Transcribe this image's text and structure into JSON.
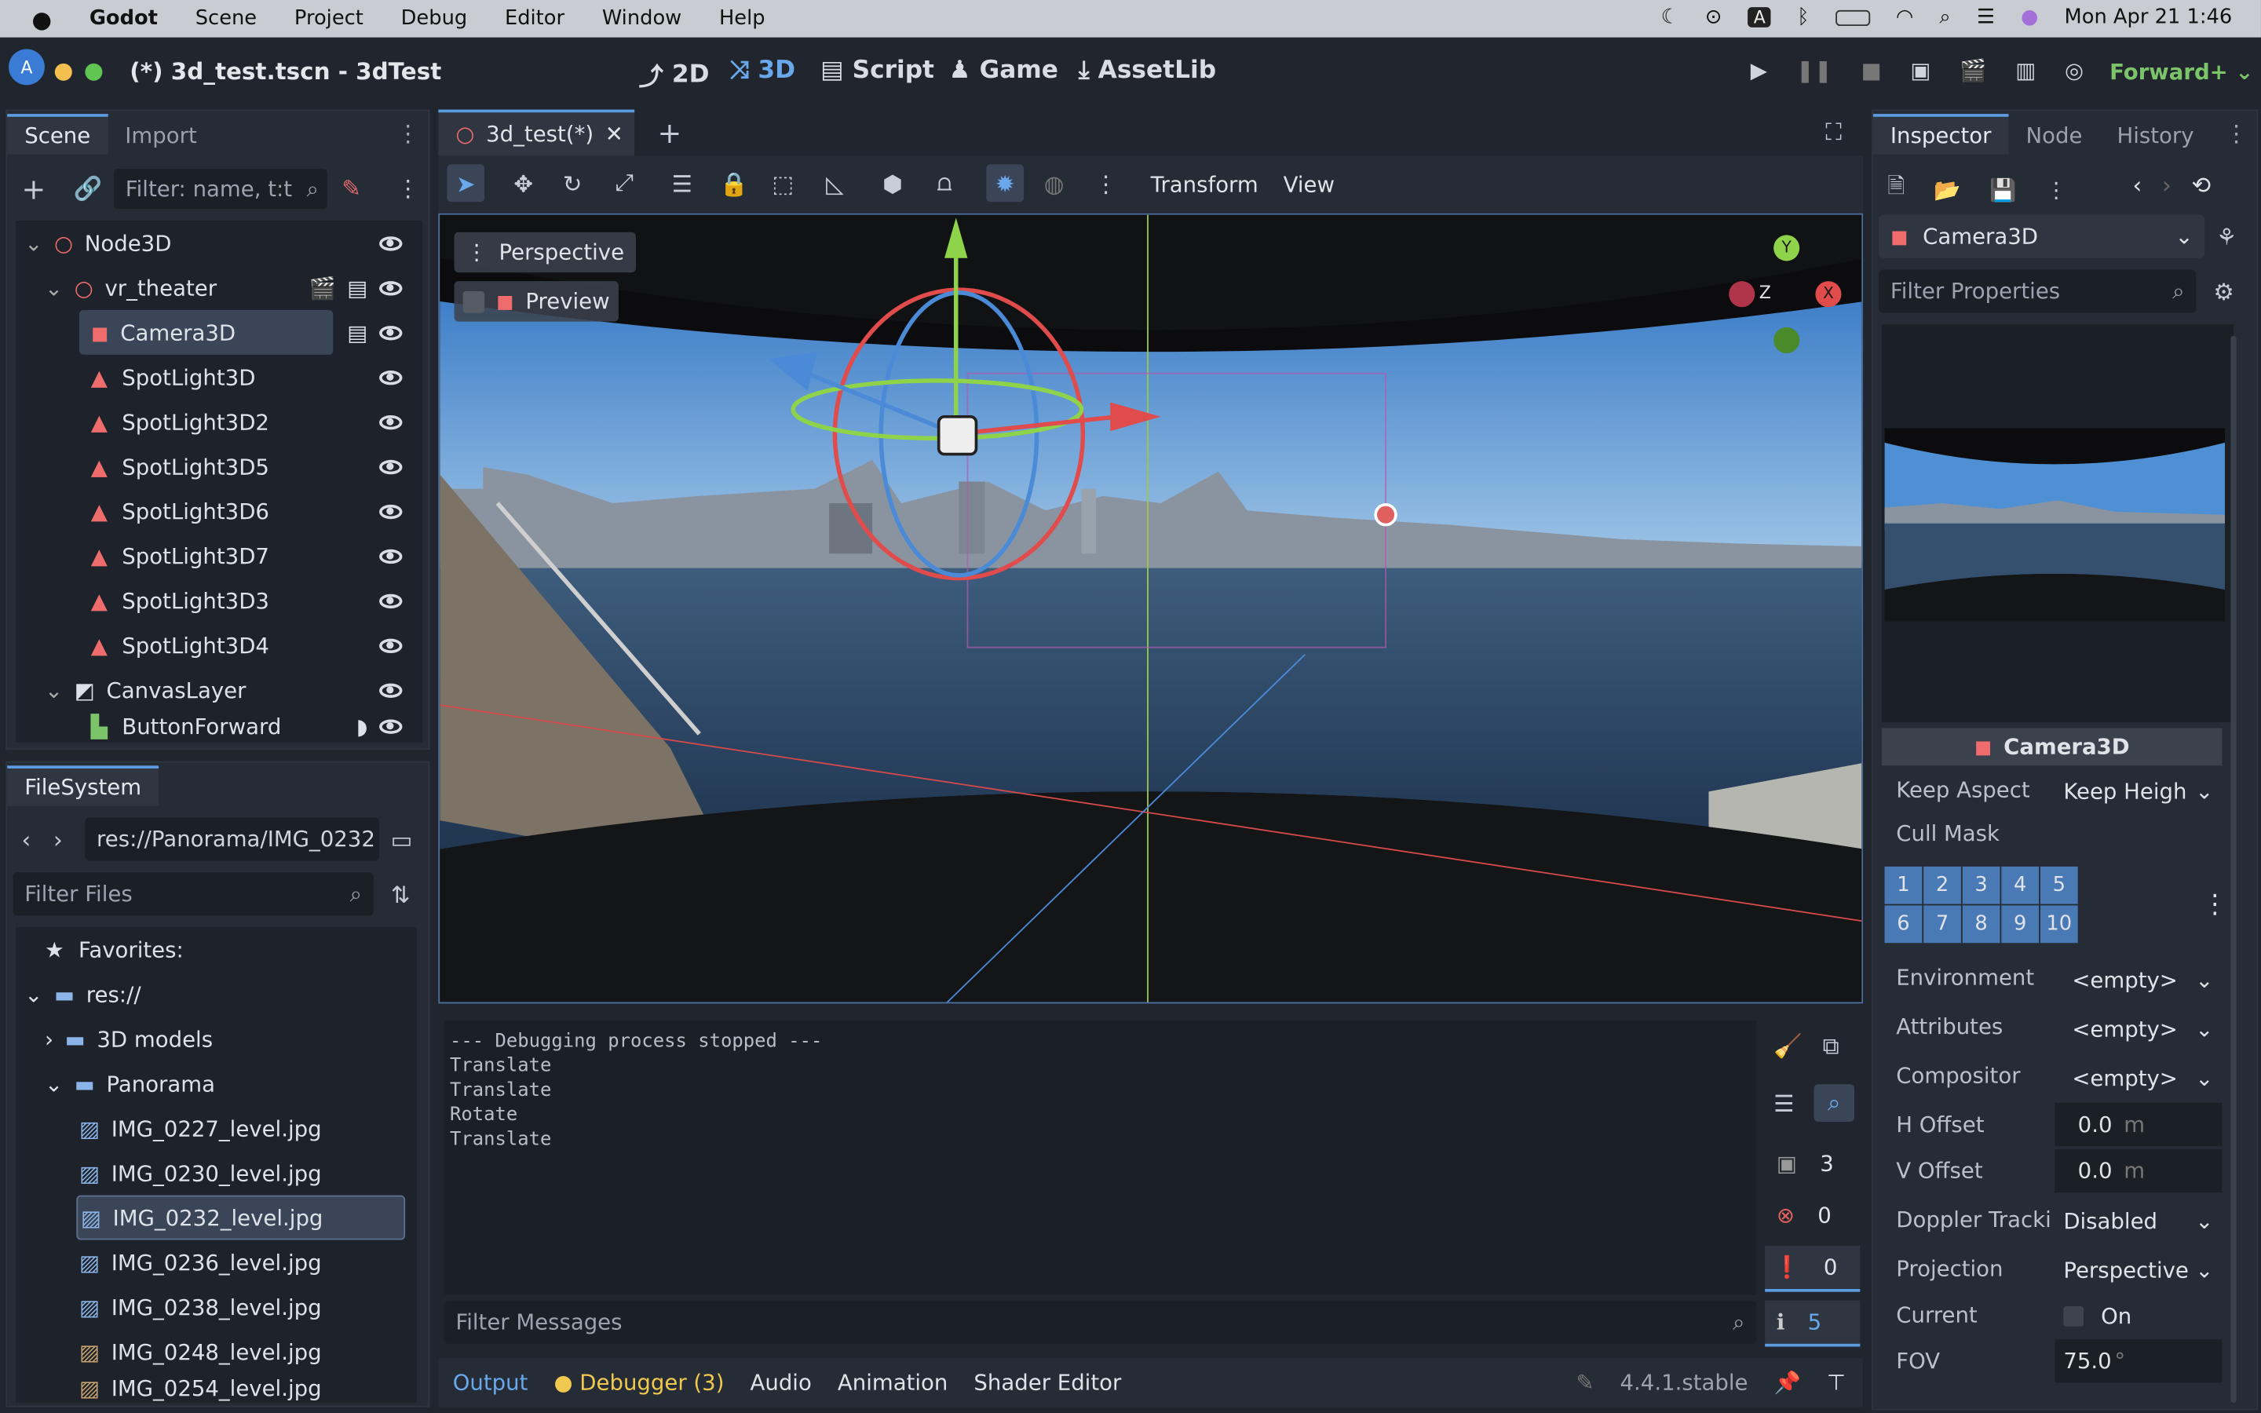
{
  "menubar": {
    "items": [
      "Godot",
      "Scene",
      "Project",
      "Debug",
      "Editor",
      "Window",
      "Help"
    ],
    "input_badge": "A",
    "clock": "Mon Apr 21  1:46"
  },
  "titlebar": {
    "title": "(*) 3d_test.tscn - 3dTest",
    "main_buttons": [
      "2D",
      "3D",
      "Script",
      "Game",
      "AssetLib"
    ],
    "renderer": "Forward+"
  },
  "scene_dock": {
    "tabs": [
      "Scene",
      "Import"
    ],
    "filter_placeholder": "Filter: name, t:t",
    "nodes": [
      "Node3D",
      "vr_theater",
      "Camera3D",
      "SpotLight3D",
      "SpotLight3D2",
      "SpotLight3D5",
      "SpotLight3D6",
      "SpotLight3D7",
      "SpotLight3D3",
      "SpotLight3D4",
      "CanvasLayer",
      "ButtonForward"
    ]
  },
  "filesystem": {
    "tab": "FileSystem",
    "path": "res://Panorama/IMG_0232",
    "filter_placeholder": "Filter Files",
    "favorites": "Favorites:",
    "root": "res://",
    "folders": [
      "3D models",
      "Panorama"
    ],
    "files": [
      "IMG_0227_level.jpg",
      "IMG_0230_level.jpg",
      "IMG_0232_level.jpg",
      "IMG_0236_level.jpg",
      "IMG_0238_level.jpg",
      "IMG_0248_level.jpg",
      "IMG_0254_level.jpg"
    ]
  },
  "viewport": {
    "tab": "3d_test(*)",
    "menus": [
      "Transform",
      "View"
    ],
    "perspective": "Perspective",
    "preview": "Preview",
    "gizmo": {
      "y": "Y",
      "z": "Z",
      "x": "X"
    }
  },
  "output": {
    "lines": [
      "--- Debugging process stopped ---",
      "Translate",
      "Translate",
      "Rotate",
      "Translate"
    ],
    "counts": [
      "3",
      "0",
      "0",
      "5"
    ],
    "filter_placeholder": "Filter Messages",
    "bottom_tabs": [
      "Output",
      "Debugger (3)",
      "Audio",
      "Animation",
      "Shader Editor"
    ],
    "version": "4.4.1.stable"
  },
  "inspector": {
    "tabs": [
      "Inspector",
      "Node",
      "History"
    ],
    "object": "Camera3D",
    "filter_placeholder": "Filter Properties",
    "section": "Camera3D",
    "props": [
      {
        "label": "Keep Aspect",
        "value": "Keep Heigh"
      },
      {
        "label": "Cull Mask",
        "value": ""
      }
    ],
    "layers": [
      "1",
      "2",
      "3",
      "4",
      "5",
      "6",
      "7",
      "8",
      "9",
      "10"
    ],
    "props2": [
      {
        "label": "Environment",
        "value": "<empty>"
      },
      {
        "label": "Attributes",
        "value": "<empty>"
      },
      {
        "label": "Compositor",
        "value": "<empty>"
      },
      {
        "label": "H Offset",
        "value": "0.0",
        "unit": "m"
      },
      {
        "label": "V Offset",
        "value": "0.0",
        "unit": "m"
      },
      {
        "label": "Doppler Tracki",
        "value": "Disabled"
      },
      {
        "label": "Projection",
        "value": "Perspective"
      },
      {
        "label": "Current",
        "value": "On"
      },
      {
        "label": "FOV",
        "value": "75.0",
        "unit": "°"
      }
    ]
  }
}
